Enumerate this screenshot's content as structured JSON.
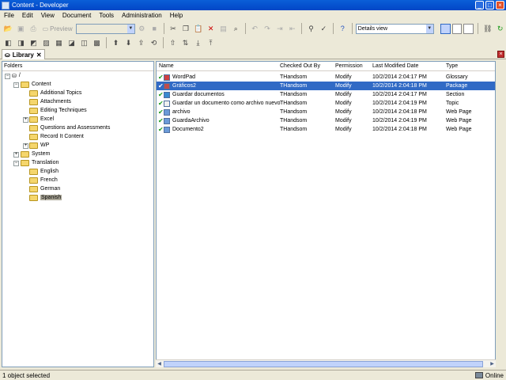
{
  "window": {
    "title": "Content - Developer"
  },
  "menu": [
    "File",
    "Edit",
    "View",
    "Document",
    "Tools",
    "Administration",
    "Help"
  ],
  "toolbar": {
    "preview_label": "Preview",
    "view_combo": "Details view"
  },
  "tab": {
    "label": "Library"
  },
  "folders": {
    "header": "Folders",
    "root": "/",
    "items": [
      "Content",
      "Additional Topics",
      "Attachments",
      "Editing Techniques",
      "Excel",
      "Questions and Assessments",
      "Record It Content",
      "WP",
      "System",
      "Translation",
      "English",
      "French",
      "German",
      "Spanish"
    ]
  },
  "list": {
    "columns": [
      "Name",
      "Checked Out By",
      "Permission",
      "Last Modified Date",
      "Type"
    ],
    "rows": [
      {
        "name": "WordPad",
        "checked_out_by": "THandsom",
        "permission": "Modify",
        "modified": "10/2/2014 2:04:17 PM",
        "type": "Glossary"
      },
      {
        "name": "Gráficos2",
        "checked_out_by": "THandsom",
        "permission": "Modify",
        "modified": "10/2/2014 2:04:18 PM",
        "type": "Package"
      },
      {
        "name": "Guardar documentos",
        "checked_out_by": "THandsom",
        "permission": "Modify",
        "modified": "10/2/2014 2:04:17 PM",
        "type": "Section"
      },
      {
        "name": "Guardar un documento como archivo nuevo",
        "checked_out_by": "THandsom",
        "permission": "Modify",
        "modified": "10/2/2014 2:04:19 PM",
        "type": "Topic"
      },
      {
        "name": "archivo",
        "checked_out_by": "THandsom",
        "permission": "Modify",
        "modified": "10/2/2014 2:04:18 PM",
        "type": "Web Page"
      },
      {
        "name": "GuardaArchivo",
        "checked_out_by": "THandsom",
        "permission": "Modify",
        "modified": "10/2/2014 2:04:19 PM",
        "type": "Web Page"
      },
      {
        "name": "Documento2",
        "checked_out_by": "THandsom",
        "permission": "Modify",
        "modified": "10/2/2014 2:04:18 PM",
        "type": "Web Page"
      }
    ]
  },
  "status": {
    "left": "1 object selected",
    "right": "Online"
  },
  "colors": {
    "selection": "#316ac5",
    "titlebar": "#0a5fd8",
    "check": "#1a9a1a"
  }
}
